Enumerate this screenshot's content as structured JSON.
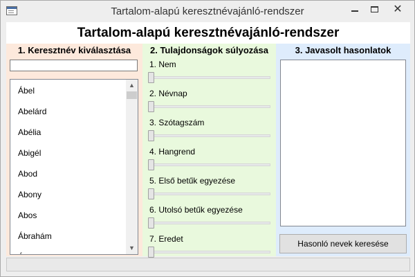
{
  "window": {
    "title": "Tartalom-alapú keresztnévajánló-rendszer",
    "minimize_glyph": "",
    "close_glyph": "✕"
  },
  "main_title": "Tartalom-alapú keresztnévajánló-rendszer",
  "column1": {
    "heading": "1. Keresztnév kiválasztása",
    "search_value": "",
    "names": [
      "Ábel",
      "Abelárd",
      "Abélia",
      "Abigél",
      "Abod",
      "Abony",
      "Abos",
      "Ábrahám",
      "Á"
    ]
  },
  "column2": {
    "heading": "2. Tulajdonságok súlyozása",
    "weights": [
      {
        "label": "1. Nem",
        "value": 0
      },
      {
        "label": "2. Névnap",
        "value": 0
      },
      {
        "label": "3. Szótagszám",
        "value": 0
      },
      {
        "label": "4. Hangrend",
        "value": 0
      },
      {
        "label": "5. Első betűk egyezése",
        "value": 0
      },
      {
        "label": "6. Utolsó betűk egyezése",
        "value": 0
      },
      {
        "label": "7. Eredet",
        "value": 0
      }
    ]
  },
  "column3": {
    "heading": "3. Javasolt hasonlatok",
    "search_button_label": "Hasonló nevek keresése"
  },
  "colors": {
    "col1_bg": "#fde9dc",
    "col2_bg": "#e9f9dd",
    "col3_bg": "#deecfc"
  }
}
